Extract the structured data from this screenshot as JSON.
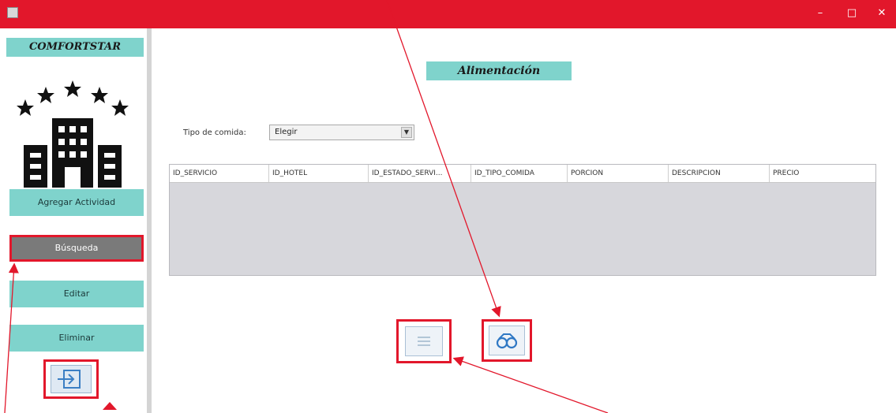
{
  "window": {
    "minimize": "–",
    "maximize": "□",
    "close": "✕"
  },
  "sidebar": {
    "brand": "COMFORTSTAR",
    "items": [
      {
        "label": "Agregar Actividad"
      },
      {
        "label": "Búsqueda"
      },
      {
        "label": "Editar"
      },
      {
        "label": "Eliminar"
      }
    ],
    "exit_icon": "exit-icon"
  },
  "main": {
    "title": "Alimentación",
    "filter_label": "Tipo de comida:",
    "filter_value": "Elegir",
    "table": {
      "columns": [
        "ID_SERVICIO",
        "ID_HOTEL",
        "ID_ESTADO_SERVI...",
        "ID_TIPO_COMIDA",
        "PORCION",
        "DESCRIPCION",
        "PRECIO"
      ]
    },
    "buttons": [
      {
        "name": "list-button",
        "icon": "list-icon"
      },
      {
        "name": "search-button",
        "icon": "binoculars-icon"
      }
    ]
  },
  "colors": {
    "titlebar": "#e2172b",
    "accent": "#7fd3cc",
    "active": "#7a7a7a",
    "annotation": "#e2172b"
  }
}
